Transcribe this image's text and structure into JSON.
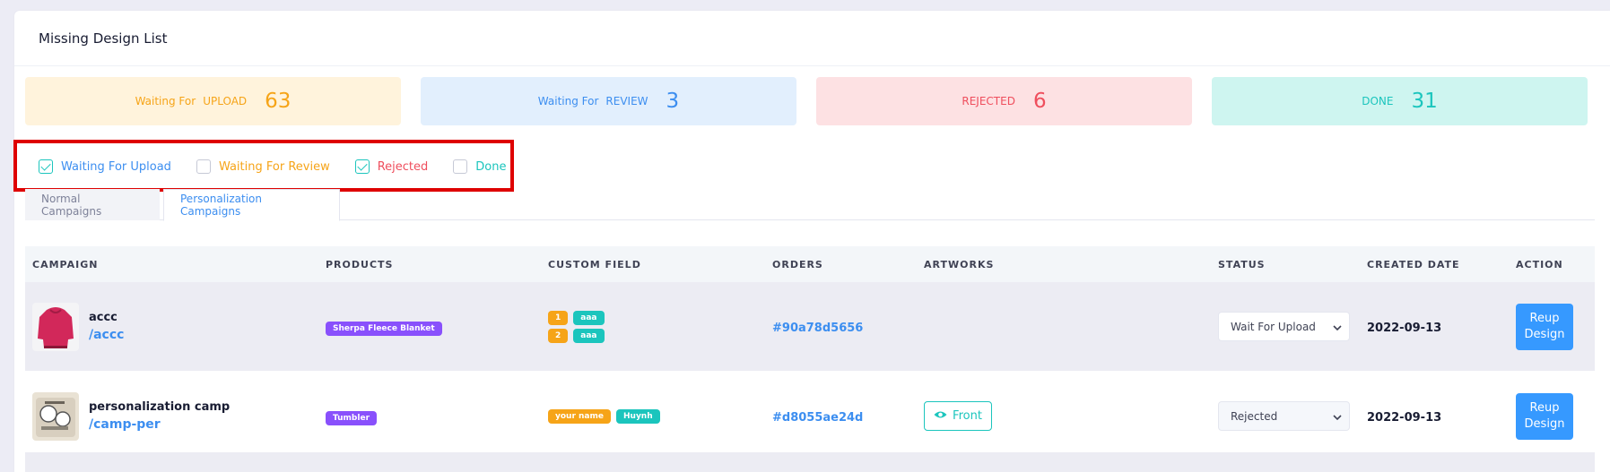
{
  "page": {
    "title": "Missing Design List"
  },
  "stats": [
    {
      "small": "Waiting For",
      "key": "UPLOAD",
      "count": "63",
      "color": "#f6a418"
    },
    {
      "small": "Waiting For",
      "key": "REVIEW",
      "count": "3",
      "color": "#3c8ef0"
    },
    {
      "small": "",
      "key": "REJECTED",
      "count": "6",
      "color": "#ef4e5d"
    },
    {
      "small": "",
      "key": "DONE",
      "count": "31",
      "color": "#1bc5bd"
    }
  ],
  "filters": [
    {
      "label": "Waiting For Upload",
      "checked": true
    },
    {
      "label": "Waiting For Review",
      "checked": false
    },
    {
      "label": "Rejected",
      "checked": true
    },
    {
      "label": "Done",
      "checked": false
    }
  ],
  "tabs": [
    {
      "label": "Normal Campaigns",
      "active": false
    },
    {
      "label": "Personalization Campaigns",
      "active": true
    }
  ],
  "table": {
    "headers": [
      "CAMPAIGN",
      "PRODUCTS",
      "CUSTOM FIELD",
      "ORDERS",
      "ARTWORKS",
      "STATUS",
      "CREATED DATE",
      "ACTION"
    ],
    "rows": [
      {
        "name": "accc",
        "slug": "/accc",
        "thumbnail_icon": "hoodie-thumbnail",
        "product": "Sherpa Fleece Blanket",
        "custom_fields": [
          {
            "index": "1",
            "value": "aaa"
          },
          {
            "index": "2",
            "value": "aaa"
          }
        ],
        "order": "#90a78d5656",
        "artwork": "",
        "status": "Wait For Upload",
        "created": "2022-09-13",
        "action": "Reup Design"
      },
      {
        "name": "personalization camp",
        "slug": "/camp-per",
        "thumbnail_icon": "tumbler-thumbnail",
        "product": "Tumbler",
        "custom_fields": [
          {
            "index": "your name",
            "value": "Huynh"
          }
        ],
        "order": "#d8055ae24d",
        "artwork": "Front",
        "status": "Rejected",
        "created": "2022-09-13",
        "action": "Reup Design"
      }
    ]
  }
}
